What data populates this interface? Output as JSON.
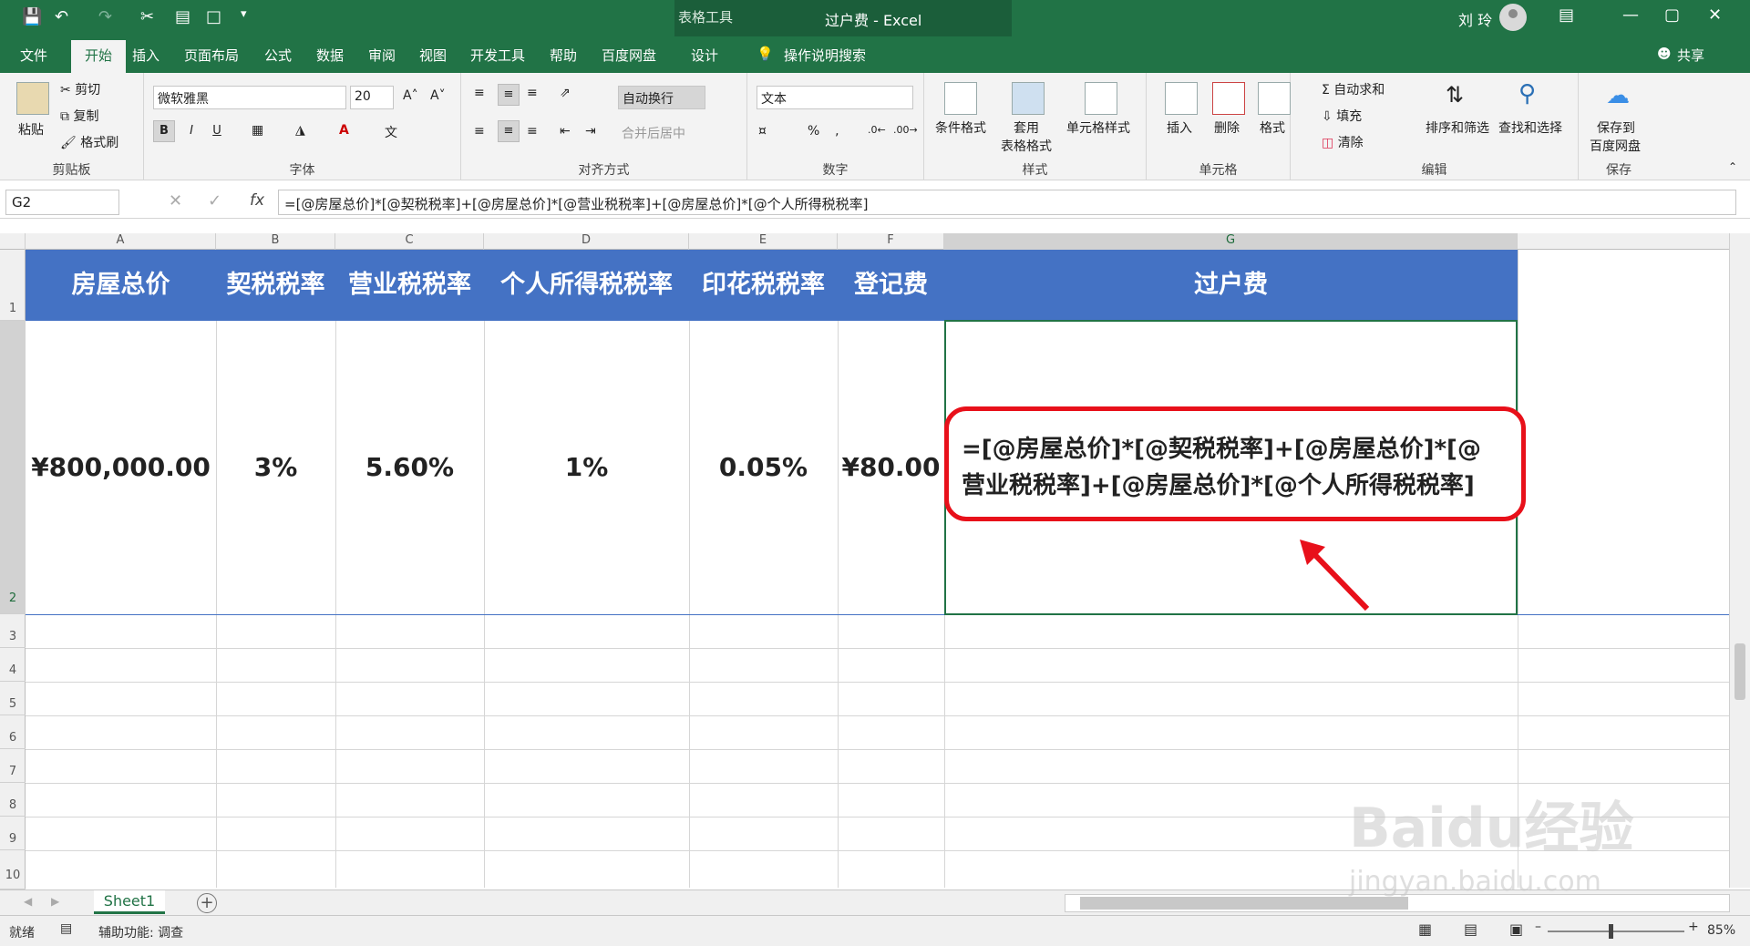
{
  "window": {
    "title": "过户费 - Excel",
    "context_tab_group": "表格工具",
    "user": "刘 玲",
    "controls": [
      "—",
      "▢",
      "✕"
    ]
  },
  "menu": {
    "tabs": [
      "文件",
      "开始",
      "插入",
      "页面布局",
      "公式",
      "数据",
      "审阅",
      "视图",
      "开发工具",
      "帮助",
      "百度网盘",
      "设计"
    ],
    "active": "开始",
    "search": "操作说明搜索",
    "share": "共享"
  },
  "ribbon": {
    "clipboard": {
      "paste": "粘贴",
      "cut": "剪切",
      "copy": "复制",
      "painter": "格式刷",
      "label": "剪贴板"
    },
    "font": {
      "name": "微软雅黑",
      "size": "20",
      "label": "字体"
    },
    "alignment": {
      "wrap": "自动换行",
      "merge": "合并后居中",
      "label": "对齐方式"
    },
    "number": {
      "format": "文本",
      "label": "数字"
    },
    "styles": {
      "cond": "条件格式",
      "table_line1": "套用",
      "table_line2": "表格格式",
      "cell": "单元格样式",
      "label": "样式"
    },
    "cells": {
      "insert": "插入",
      "delete": "删除",
      "format": "格式",
      "label": "单元格"
    },
    "editing": {
      "autosum": "自动求和",
      "fill": "填充",
      "clear": "清除",
      "sort": "排序和筛选",
      "find": "查找和选择",
      "label": "编辑"
    },
    "save": {
      "line1": "保存到",
      "line2": "百度网盘",
      "label": "保存"
    }
  },
  "formula_bar": {
    "cell_ref": "G2",
    "fx": "fx",
    "formula": "=[@房屋总价]*[@契税税率]+[@房屋总价]*[@营业税税率]+[@房屋总价]*[@个人所得税税率]"
  },
  "columns": [
    "A",
    "B",
    "C",
    "D",
    "E",
    "F",
    "G"
  ],
  "rows": [
    "1",
    "2",
    "3",
    "4",
    "5",
    "6",
    "7",
    "8",
    "9",
    "10"
  ],
  "table": {
    "headers": [
      "房屋总价",
      "契税税率",
      "营业税税率",
      "个人所得税税率",
      "印花税税率",
      "登记费",
      "过户费"
    ],
    "row2": [
      "¥800,000.00",
      "3%",
      "5.60%",
      "1%",
      "0.05%",
      "¥80.00"
    ],
    "header_color": "#4472c4"
  },
  "callout": {
    "line1": "=[@房屋总价]*[@契税税率]+[@房屋总价]*[@",
    "line2": "营业税税率]+[@房屋总价]*[@个人所得税税率]",
    "border_color": "#e8101a"
  },
  "sheets": {
    "active": "Sheet1"
  },
  "status": {
    "ready": "就绪",
    "accessibility": "辅助功能: 调查",
    "zoom": "85%"
  },
  "watermark": {
    "line1": "Baidu经验",
    "line2": "jingyan.baidu.com"
  }
}
